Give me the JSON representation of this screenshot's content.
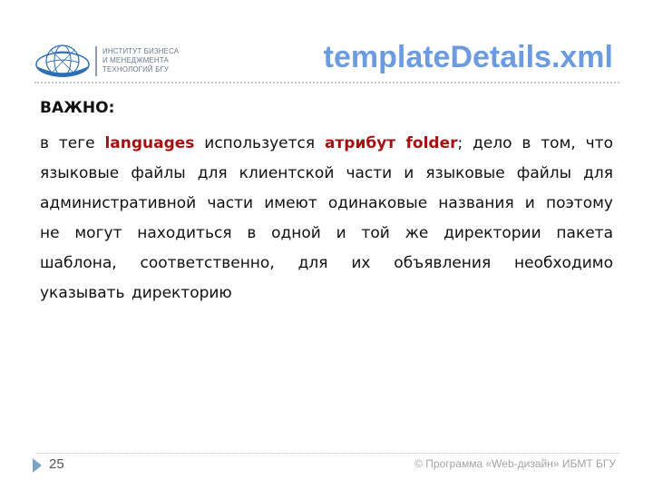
{
  "header": {
    "logo_lines": [
      "ИНСТИТУТ БИЗНЕСА",
      "И МЕНЕДЖМЕНТА",
      "ТЕХНОЛОГИЙ БГУ"
    ],
    "logo_icon": "globe-icon",
    "title": "templateDetails.xml"
  },
  "body": {
    "heading": "ВАЖНО:",
    "para_parts": [
      "в теге ",
      "languages",
      " используется ",
      "атрибут folder",
      "; дело в том, что языковые файлы для клиентской части и языковые файлы для административной части имеют одинаковые названия и поэтому не могут находиться в одной и той же директории пакета шаблона, соответственно, для их объявления необходимо указывать директорию"
    ],
    "highlight_color": "#a61010"
  },
  "footer": {
    "arrow_icon": "triangle-right-icon",
    "page_number": "25",
    "copyright": "© Программа «Web-дизайн» ИБМТ БГУ"
  },
  "colors": {
    "title": "#6c9be0",
    "text": "#111111",
    "footer_text": "#a3a3a3",
    "accent_arrow": "#7fa1c6"
  }
}
